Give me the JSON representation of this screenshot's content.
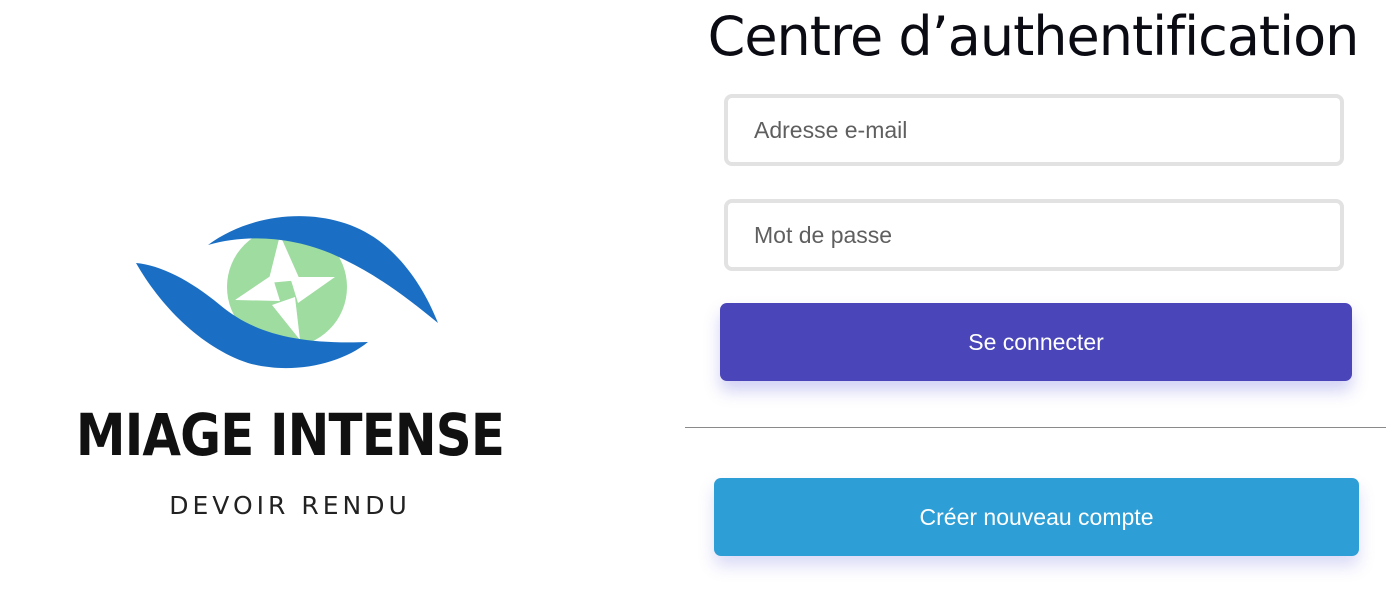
{
  "brand": {
    "name": "MIAGE INTENSE",
    "tagline": "DEVOIR RENDU",
    "colors": {
      "swoosh": "#1a6fc4",
      "iris": "#9fdca0"
    }
  },
  "login_form": {
    "title": "Centre d’authentification",
    "email_placeholder": "Adresse e-mail",
    "password_placeholder": "Mot de passe",
    "login_label": "Se connecter",
    "create_account_label": "Créer nouveau compte",
    "colors": {
      "login_button": "#4a45b8",
      "create_button": "#2e9fd6"
    }
  }
}
